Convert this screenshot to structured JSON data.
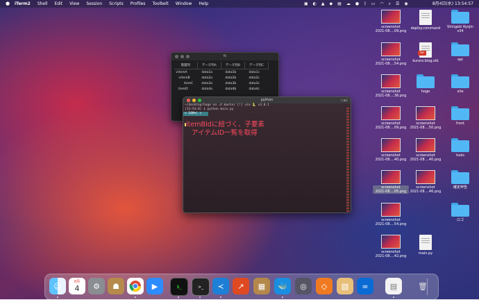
{
  "menubar": {
    "apple": "",
    "items": [
      "iTerm2",
      "Shell",
      "Edit",
      "View",
      "Session",
      "Scripts",
      "Profiles",
      "Toolbelt",
      "Window",
      "Help"
    ],
    "clock": "8月4日(水) 13:54:57"
  },
  "fk_window": {
    "title": "fk",
    "headers": [
      "階層列",
      "データ列A",
      "データ列B",
      "データ列C"
    ],
    "rows": [
      {
        "name": "∨itemA",
        "a": "data1a",
        "b": "data1b",
        "c": "data1c"
      },
      {
        "name": "∨itemB",
        "a": "data2a",
        "b": "data2b",
        "c": "data2c"
      },
      {
        "name": "itemC",
        "a": "data3a",
        "b": "data3b",
        "c": "data3c"
      },
      {
        "name": "itemD",
        "a": "data4a",
        "b": "data4b",
        "c": "data4c"
      }
    ]
  },
  "terminal": {
    "title": "python",
    "shortcut": "⌥⌘1",
    "line1": "~/desktop/hoge on ⎇ master [!] via 🐍 v3.8.1",
    "line2": "(13:54:0) ❯ python main.py",
    "line3": "< 100%) >"
  },
  "annotation": {
    "line1": "itemBIdに紐づく、子要素",
    "line2": "アイテムID一覧を取得"
  },
  "desktop": [
    {
      "kind": "thumb",
      "label1": "screenshot",
      "label2": "2021-08....09.png"
    },
    {
      "kind": "doc",
      "label1": "deploy.command",
      "label2": ""
    },
    {
      "kind": "folder",
      "label1": "Shingeki Kyojin",
      "label2": "v34"
    },
    {
      "kind": "thumb",
      "label1": "screenshot",
      "label2": "2021-08....54.png"
    },
    {
      "kind": "doc",
      "label1": "kuroro.blog.stk",
      "label2": "",
      "badge": "PDF"
    },
    {
      "kind": "folder",
      "label1": "api",
      "label2": ""
    },
    {
      "kind": "thumb",
      "label1": "screenshot",
      "label2": "2021-08....36.png"
    },
    {
      "kind": "folder",
      "label1": "hoge",
      "label2": ""
    },
    {
      "kind": "folder",
      "label1": "site",
      "label2": ""
    },
    {
      "kind": "thumb",
      "label1": "screenshot",
      "label2": "2021-08....09.png"
    },
    {
      "kind": "thumb",
      "label1": "screenshot",
      "label2": "2021-08....50.png"
    },
    {
      "kind": "folder",
      "label1": "front",
      "label2": ""
    },
    {
      "kind": "thumb",
      "label1": "screenshot",
      "label2": "2021-08....40.png"
    },
    {
      "kind": "thumb",
      "label1": "screenshot",
      "label2": "2021-08....40.png"
    },
    {
      "kind": "folder",
      "label1": "tools",
      "label2": ""
    },
    {
      "kind": "thumb",
      "label1": "screenshot",
      "label2": "2021-08....05.png",
      "selected": true
    },
    {
      "kind": "thumb",
      "label1": "screenshot",
      "label2": "2021-08....46.png"
    },
    {
      "kind": "folder",
      "label1": "確定申告",
      "label2": ""
    },
    {
      "kind": "thumb",
      "label1": "screenshot",
      "label2": "2021-08....54.png"
    },
    {
      "kind": "folder",
      "label1": "ロゴ",
      "label2": ""
    },
    {
      "kind": "thumb",
      "label1": "screenshot",
      "label2": "2021-08....42.png"
    },
    {
      "kind": "doc",
      "label1": "main.py",
      "label2": ""
    }
  ],
  "dock": {
    "calendar_month": "8月",
    "calendar_day": "4",
    "icons": [
      "finder-icon",
      "calendar-icon",
      "system-preferences-icon",
      "contacts-icon",
      "chrome-icon",
      "zoom-icon",
      "terminal-icon",
      "iterm-icon",
      "vscode-icon",
      "stocks-icon",
      "archive-icon",
      "docker-icon",
      "quicktime-icon",
      "git-icon",
      "preview-icon",
      "infinity-icon",
      "document-icon",
      "trash-icon"
    ]
  }
}
